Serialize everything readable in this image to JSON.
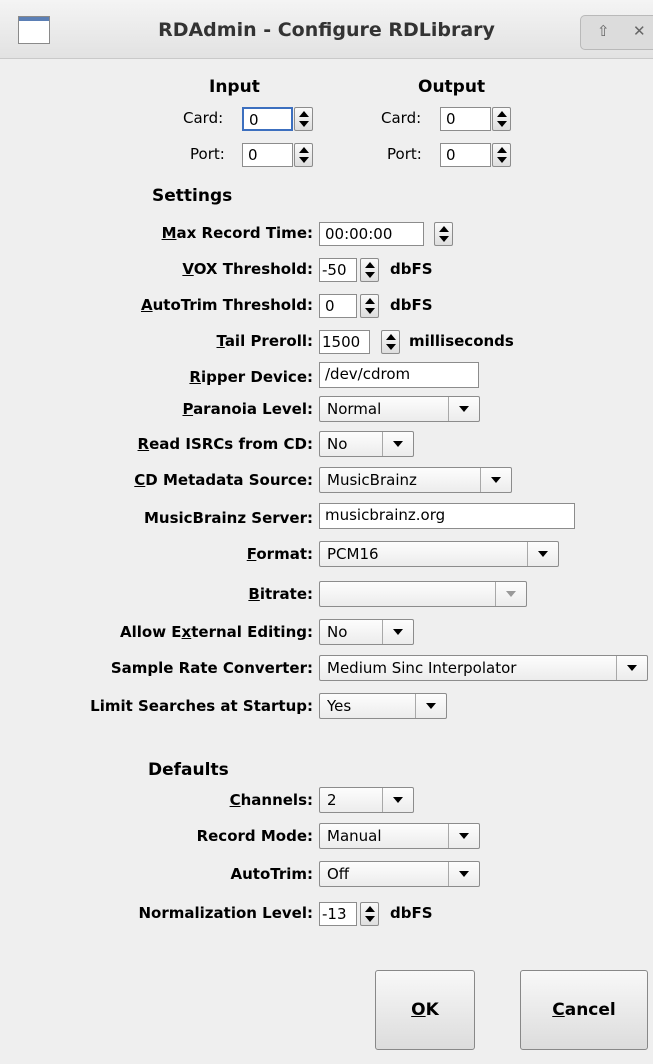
{
  "window": {
    "title": "RDAdmin - Configure RDLibrary",
    "controls": [
      "⇧",
      "✕"
    ]
  },
  "input": {
    "heading": "Input",
    "card_label": "Card:",
    "card_value": "0",
    "port_label": "Port:",
    "port_value": "0"
  },
  "output": {
    "heading": "Output",
    "card_label": "Card:",
    "card_value": "0",
    "port_label": "Port:",
    "port_value": "0"
  },
  "settings": {
    "heading": "Settings",
    "max_record_time": {
      "label_u": "M",
      "label_rest": "ax Record Time:",
      "value": "00:00:00"
    },
    "vox_threshold": {
      "label_u": "V",
      "label_rest": "OX Threshold:",
      "value": "-50",
      "unit": "dbFS"
    },
    "autotrim_threshold": {
      "label_u": "A",
      "label_rest": "utoTrim Threshold:",
      "value": "0",
      "unit": "dbFS"
    },
    "tail_preroll": {
      "label_u": "T",
      "label_rest": "ail Preroll:",
      "value": "1500",
      "unit": "milliseconds"
    },
    "ripper_device": {
      "label_u": "R",
      "label_rest": "ipper Device:",
      "value": "/dev/cdrom"
    },
    "paranoia_level": {
      "label_u": "P",
      "label_rest": "aranoia Level:",
      "value": "Normal"
    },
    "read_isrcs": {
      "label_u": "R",
      "label_rest": "ead ISRCs from CD:",
      "value": "No"
    },
    "cd_metadata_source": {
      "label_u": "C",
      "label_rest": "D Metadata Source:",
      "value": "MusicBrainz"
    },
    "musicbrainz_server": {
      "label": "MusicBrainz Server:",
      "value": "musicbrainz.org"
    },
    "format": {
      "label_u": "F",
      "label_rest": "ormat:",
      "value": "PCM16"
    },
    "bitrate": {
      "label_u": "B",
      "label_rest": "itrate:",
      "value": ""
    },
    "allow_external_editing": {
      "label_pre": "Allow E",
      "label_u": "x",
      "label_rest": "ternal Editing:",
      "value": "No"
    },
    "sample_rate_converter": {
      "label": "Sample Rate Converter:",
      "value": "Medium Sinc Interpolator"
    },
    "limit_searches": {
      "label": "Limit Searches at Startup:",
      "value": "Yes"
    }
  },
  "defaults": {
    "heading": "Defaults",
    "channels": {
      "label_u": "C",
      "label_rest": "hannels:",
      "value": "2"
    },
    "record_mode": {
      "label": "Record Mode:",
      "value": "Manual"
    },
    "autotrim": {
      "label": "AutoTrim:",
      "value": "Off"
    },
    "normalization_level": {
      "label": "Normalization Level:",
      "value": "-13",
      "unit": "dbFS"
    }
  },
  "buttons": {
    "ok": {
      "label_u": "O",
      "label_rest": "K"
    },
    "cancel": {
      "label_u": "C",
      "label_rest": "ancel"
    }
  }
}
